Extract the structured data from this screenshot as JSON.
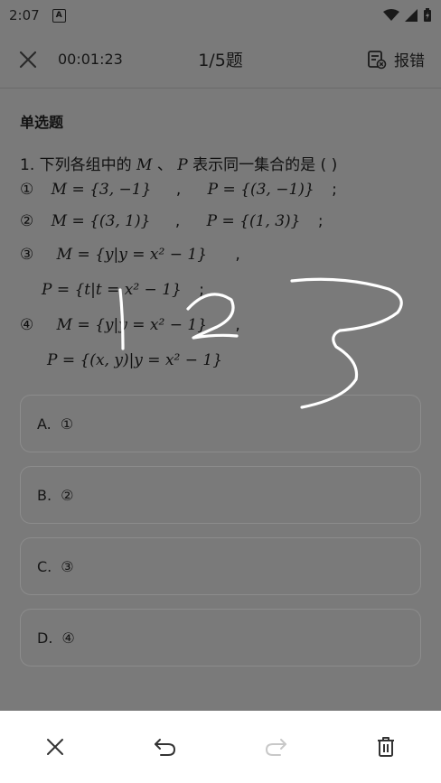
{
  "status_bar": {
    "time": "2:07",
    "app_badge": "A"
  },
  "header": {
    "timer": "00:01:23",
    "progress": "1/5题",
    "report_label": "报错"
  },
  "question": {
    "section_title": "单选题",
    "stem_prefix": "1. 下列各组中的",
    "stem_var1": "M",
    "stem_sep": "、",
    "stem_var2": "P",
    "stem_suffix": "表示同一集合的是 (    )",
    "items": [
      {
        "num": "①",
        "m": "M = {3, −1}",
        "sep": ",",
        "p": "P = {(3, −1)}",
        "end": ";"
      },
      {
        "num": "②",
        "m": "M = {(3, 1)}",
        "sep": ",",
        "p": "P = {(1, 3)}",
        "end": ";"
      },
      {
        "num": "③",
        "m": "M = {y|y = x² − 1}",
        "sep": ",",
        "p": "P = {t|t = x² − 1}",
        "end": ";"
      },
      {
        "num": "④",
        "m": "M = {y|y = x² − 1}",
        "sep": ",",
        "p": "P = {(x, y)|y = x² − 1}",
        "end": ""
      }
    ]
  },
  "options": [
    {
      "label": "A.",
      "value": "①"
    },
    {
      "label": "B.",
      "value": "②"
    },
    {
      "label": "C.",
      "value": "③"
    },
    {
      "label": "D.",
      "value": "④"
    }
  ],
  "colors": {
    "overlay_bg": "#7a7a7a",
    "ink": "#ffffff",
    "toolbar_bg": "#ffffff"
  }
}
